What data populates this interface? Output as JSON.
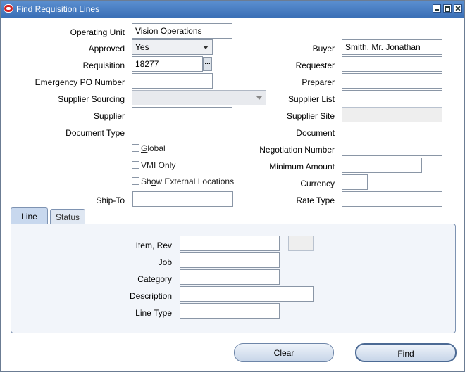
{
  "window": {
    "title": "Find Requisition Lines"
  },
  "left_form": {
    "operating_unit": {
      "label": "Operating Unit",
      "value": "Vision Operations"
    },
    "approved": {
      "label": "Approved",
      "value": "Yes"
    },
    "requisition": {
      "label": "Requisition",
      "value": "18277",
      "lov": "..."
    },
    "emergency_po": {
      "label": "Emergency PO Number",
      "value": ""
    },
    "supplier_sourcing": {
      "label": "Supplier Sourcing",
      "value": ""
    },
    "supplier": {
      "label": "Supplier",
      "value": ""
    },
    "document_type": {
      "label": "Document Type",
      "value": ""
    },
    "ship_to": {
      "label": "Ship-To",
      "value": ""
    }
  },
  "checkboxes": {
    "global": {
      "pre": "",
      "key": "G",
      "post": "lobal"
    },
    "vmi_only": {
      "pre": "V",
      "key": "M",
      "post": "I Only"
    },
    "show_external": {
      "pre": "Sh",
      "key": "o",
      "post": "w External Locations"
    }
  },
  "right_form": {
    "buyer": {
      "label": "Buyer",
      "value": "Smith, Mr. Jonathan"
    },
    "requester": {
      "label": "Requester",
      "value": ""
    },
    "preparer": {
      "label": "Preparer",
      "value": ""
    },
    "supplier_list": {
      "label": "Supplier List",
      "value": ""
    },
    "supplier_site": {
      "label": "Supplier Site",
      "value": ""
    },
    "document": {
      "label": "Document",
      "value": ""
    },
    "negotiation_number": {
      "label": "Negotiation Number",
      "value": ""
    },
    "minimum_amount": {
      "label": "Minimum Amount",
      "value": ""
    },
    "currency": {
      "label": "Currency",
      "value": ""
    },
    "rate_type": {
      "label": "Rate Type",
      "value": ""
    }
  },
  "tabs": [
    {
      "label": "Line"
    },
    {
      "label": "Status"
    }
  ],
  "line_tab": {
    "item_rev": {
      "label": "Item, Rev",
      "value": ""
    },
    "job": {
      "label": "Job",
      "value": ""
    },
    "category": {
      "label": "Category",
      "value": ""
    },
    "description": {
      "label": "Description",
      "value": ""
    },
    "line_type": {
      "label": "Line Type",
      "value": ""
    }
  },
  "buttons": {
    "clear": {
      "key": "C",
      "rest": "lear"
    },
    "find": {
      "label": "Find"
    }
  }
}
